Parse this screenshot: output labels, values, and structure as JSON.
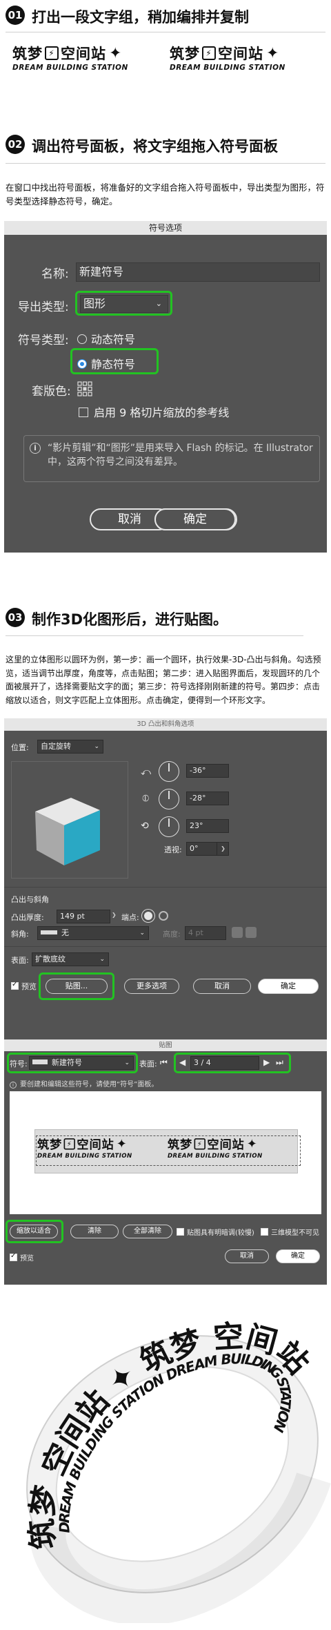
{
  "step1": {
    "num": "01",
    "title": "打出一段文字组，稍加编排并复制"
  },
  "logo": {
    "cn_a": "筑梦",
    "cn_b": "空间站",
    "en": "DREAM BUILDING STATION"
  },
  "step2": {
    "num": "02",
    "title": "调出符号面板，将文字组拖入符号面板",
    "desc": "在窗口中找出符号面板，将准备好的文字组合拖入符号面板中，导出类型为图形，符号类型选择静态符号，确定。"
  },
  "dialog1": {
    "title": "符号选项",
    "name_label": "名称:",
    "name_value": "新建符号",
    "export_label": "导出类型:",
    "export_value": "图形",
    "symtype_label": "符号类型:",
    "dynamic": "动态符号",
    "static": "静态符号",
    "reg_label": "套版色:",
    "nine_slice": "启用 9 格切片缩放的参考线",
    "info": "“影片剪辑”和“图形”是用来导入 Flash 的标记。在 Illustrator 中，这两个符号之间没有差异。",
    "cancel": "取消",
    "ok": "确定"
  },
  "step3": {
    "num": "03",
    "title": "制作3D化图形后，进行贴图。",
    "desc": "这里的立体图形以圆环为例，第一步：画一个圆环，执行效果-3D-凸出与斜角。勾选预览，适当调节出厚度，角度等，点击贴图；第二步：进入贴图界面后，发现圆环的几个面被展开了，选择需要贴文字的面；第三步：符号选择刚刚新建的符号。第四步：点击缩放以适合，则文字匹配上立体图形。点击确定，便得到一个环形文字。"
  },
  "dialog2": {
    "title": "3D 凸出和斜角选项",
    "position_label": "位置:",
    "position_value": "自定旋转",
    "x_angle": "-36°",
    "y_angle": "-28°",
    "z_angle": "23°",
    "persp_label": "透视:",
    "persp_value": "0°",
    "section": "凸出与斜角",
    "depth_label": "凸出厚度:",
    "depth_value": "149 pt",
    "cap_label": "端点:",
    "bevel_label": "斜角:",
    "bevel_value": "无",
    "height_label": "高度:",
    "height_value": "4 pt",
    "surface_label": "表面:",
    "surface_value": "扩散底纹",
    "preview": "预览",
    "map_btn": "贴图...",
    "more_btn": "更多选项",
    "cancel": "取消",
    "ok": "确定"
  },
  "dialog3": {
    "title": "贴图",
    "symbol_label": "符号:",
    "symbol_value": "新建符号",
    "surface_label": "表面:",
    "surface_value": "3 / 4",
    "hint": "要创建和编辑这些符号，请使用“符号”面板。",
    "fit_btn": "缩放以适合",
    "clear_btn": "清除",
    "clear_all_btn": "全部清除",
    "shade_chk": "贴图具有明暗调(较慢)",
    "invisible_chk": "三维模型不可见",
    "preview": "预览",
    "cancel": "取消",
    "ok": "确定"
  },
  "colors": {
    "accent_green": "#22c322",
    "panel": "#535353",
    "cube_face": "#2aa8c4"
  }
}
